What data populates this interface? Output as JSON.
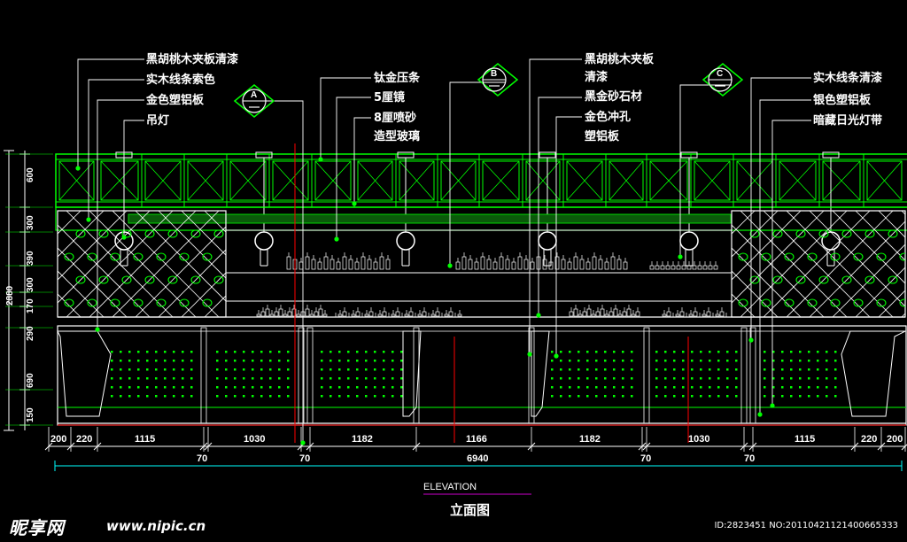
{
  "labels_left": [
    "黑胡桃木夹板清漆",
    "实木线条索色",
    "金色塑铝板",
    "吊灯"
  ],
  "labels_mid": [
    "钛金压条",
    "5厘镜",
    "8厘喷砂",
    "造型玻璃"
  ],
  "labels_right_mid": [
    "黑胡桃木夹板",
    "清漆",
    "黑金砂石材",
    "金色冲孔",
    "塑铝板"
  ],
  "labels_right": [
    "实木线条清漆",
    "银色塑铝板",
    "暗藏日光灯带"
  ],
  "section_marks": [
    "A",
    "B",
    "C"
  ],
  "dims_vertical": [
    "600",
    "300",
    "390",
    "300",
    "170",
    "290",
    "690",
    "150"
  ],
  "dim_total_height": "2880",
  "dims_bottom": [
    "200",
    "220",
    "1115",
    "1030",
    "1182",
    "1166",
    "1182",
    "1030",
    "1115",
    "220",
    "200"
  ],
  "dims_joints": [
    "70",
    "70",
    "70",
    "70"
  ],
  "dim_total_width": "6940",
  "title_en": "ELEVATION",
  "title_cn": "立面图",
  "watermark": {
    "brand": "昵享网",
    "url": "www.nipic.cn",
    "id": "ID:2823451 NO:20110421121400665333"
  },
  "colors": {
    "background": "#000000",
    "line_green": "#00ff00",
    "line_cyan": "#00ffff",
    "line_white": "#ffffff",
    "line_red": "#ff0000",
    "title_underline": "#cc00cc"
  }
}
